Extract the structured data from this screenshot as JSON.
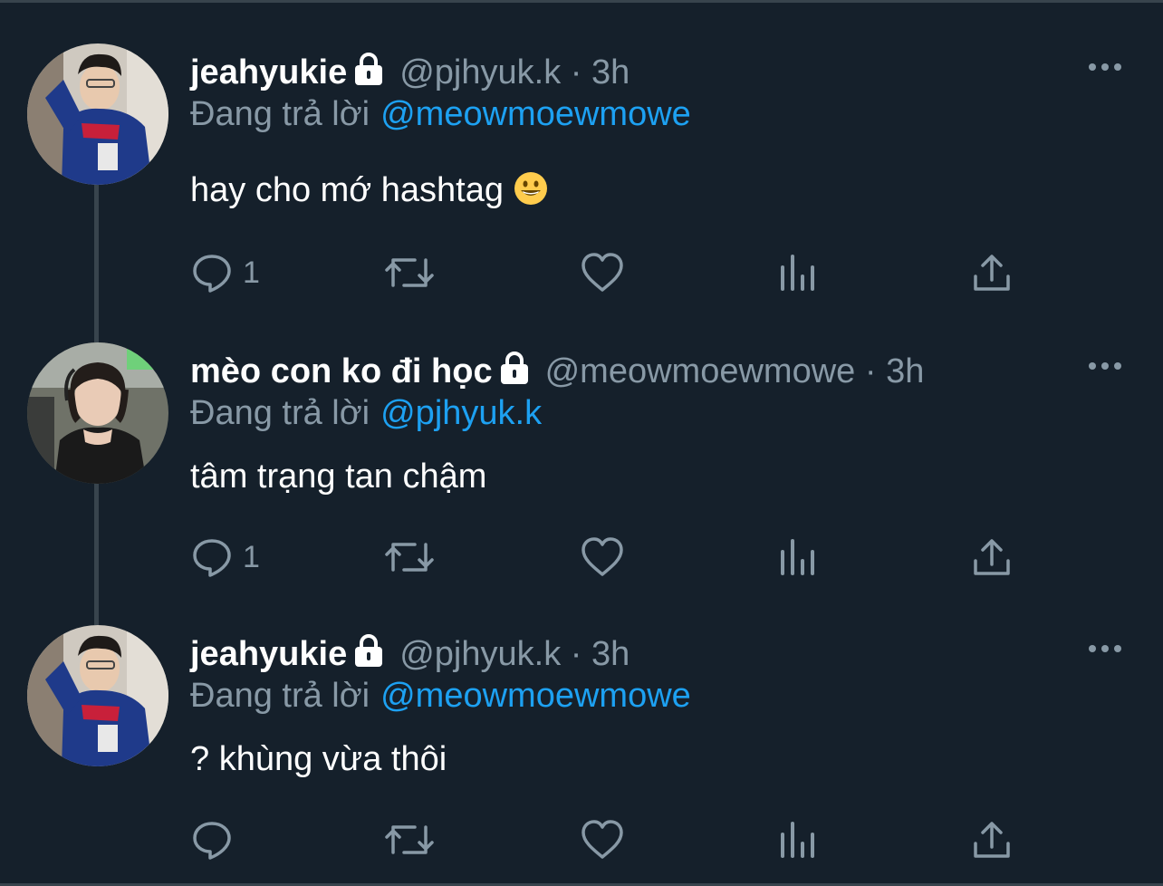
{
  "colors": {
    "background": "#15202b",
    "text_primary": "#ffffff",
    "text_secondary": "#8899a6",
    "accent_link": "#1da1f2",
    "divider": "#38444d"
  },
  "tweets": [
    {
      "display_name": "jeahyukie",
      "protected_icon": "lock-icon",
      "handle": "@pjhyuk.k",
      "separator": "·",
      "time": "3h",
      "reply_prefix": "Đang trả lời",
      "reply_to": "@meowmoewmowe",
      "text": "hay cho mớ hashtag",
      "emoji": "grinning-face-icon",
      "reply_count": "1",
      "icons": [
        "reply-icon",
        "retweet-icon",
        "like-icon",
        "stats-icon",
        "share-icon",
        "more-icon"
      ]
    },
    {
      "display_name": "mèo con ko đi học",
      "protected_icon": "lock-icon",
      "handle": "@meowmoewmowe",
      "separator": "·",
      "time": "3h",
      "reply_prefix": "Đang trả lời",
      "reply_to": "@pjhyuk.k",
      "text": "tâm trạng tan chậm",
      "reply_count": "1",
      "icons": [
        "reply-icon",
        "retweet-icon",
        "like-icon",
        "stats-icon",
        "share-icon",
        "more-icon"
      ]
    },
    {
      "display_name": "jeahyukie",
      "protected_icon": "lock-icon",
      "handle": "@pjhyuk.k",
      "separator": "·",
      "time": "3h",
      "reply_prefix": "Đang trả lời",
      "reply_to": "@meowmoewmowe",
      "text": "? khùng vừa thôi",
      "reply_count": "",
      "icons": [
        "reply-icon",
        "retweet-icon",
        "like-icon",
        "stats-icon",
        "share-icon",
        "more-icon"
      ]
    }
  ]
}
